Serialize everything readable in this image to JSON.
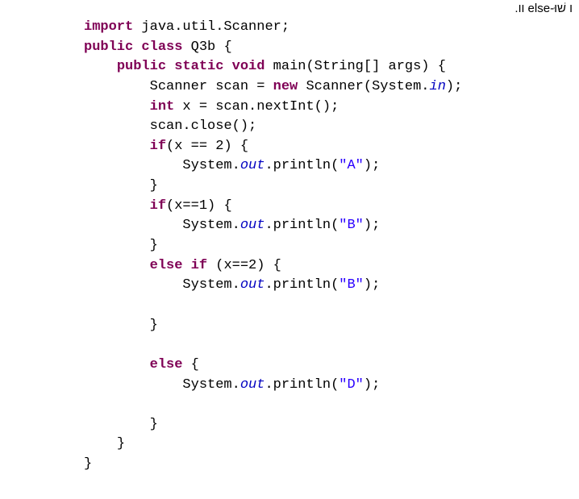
{
  "header_fragment": ".וו else-ו שׁוּ",
  "code": {
    "l1": {
      "kw_import": "import",
      "rest": " java.util.Scanner;"
    },
    "l2": {
      "kw_public": "public",
      "sp": " ",
      "kw_class": "class",
      "rest": " Q3b {"
    },
    "l3": {
      "indent": "    ",
      "kw_public": "public",
      "sp1": " ",
      "kw_static": "static",
      "sp2": " ",
      "kw_void": "void",
      "rest": " main(String[] args) {"
    },
    "l4": {
      "indent": "        ",
      "t1": "Scanner scan = ",
      "kw_new": "new",
      "t2": " Scanner(System.",
      "fld": "in",
      "t3": ");"
    },
    "l5": {
      "indent": "        ",
      "kw_int": "int",
      "rest": " x = scan.nextInt();"
    },
    "l6": {
      "indent": "        ",
      "rest": "scan.close();"
    },
    "l7": {
      "indent": "        ",
      "kw_if": "if",
      "rest": "(x == 2) {"
    },
    "l8": {
      "indent": "            ",
      "t1": "System.",
      "fld": "out",
      "t2": ".println(",
      "str": "\"A\"",
      "t3": ");"
    },
    "l9": {
      "indent": "        ",
      "rest": "}"
    },
    "l10": {
      "indent": "        ",
      "kw_if": "if",
      "rest": "(x==1) {"
    },
    "l11": {
      "indent": "            ",
      "t1": "System.",
      "fld": "out",
      "t2": ".println(",
      "str": "\"B\"",
      "t3": ");"
    },
    "l12": {
      "indent": "        ",
      "rest": "}"
    },
    "l13": {
      "indent": "        ",
      "kw_else": "else",
      "sp": " ",
      "kw_if": "if",
      "rest": " (x==2) {"
    },
    "l14": {
      "indent": "            ",
      "t1": "System.",
      "fld": "out",
      "t2": ".println(",
      "str": "\"B\"",
      "t3": ");"
    },
    "l15": {
      "indent": "",
      "rest": ""
    },
    "l16": {
      "indent": "        ",
      "rest": "}"
    },
    "l17": {
      "indent": "",
      "rest": ""
    },
    "l18": {
      "indent": "        ",
      "kw_else": "else",
      "rest": " {"
    },
    "l19": {
      "indent": "            ",
      "t1": "System.",
      "fld": "out",
      "t2": ".println(",
      "str": "\"D\"",
      "t3": ");"
    },
    "l20": {
      "indent": "",
      "rest": ""
    },
    "l21": {
      "indent": "        ",
      "rest": "}"
    },
    "l22": {
      "indent": "    ",
      "rest": "}"
    },
    "l23": {
      "indent": "",
      "rest": "}"
    }
  }
}
